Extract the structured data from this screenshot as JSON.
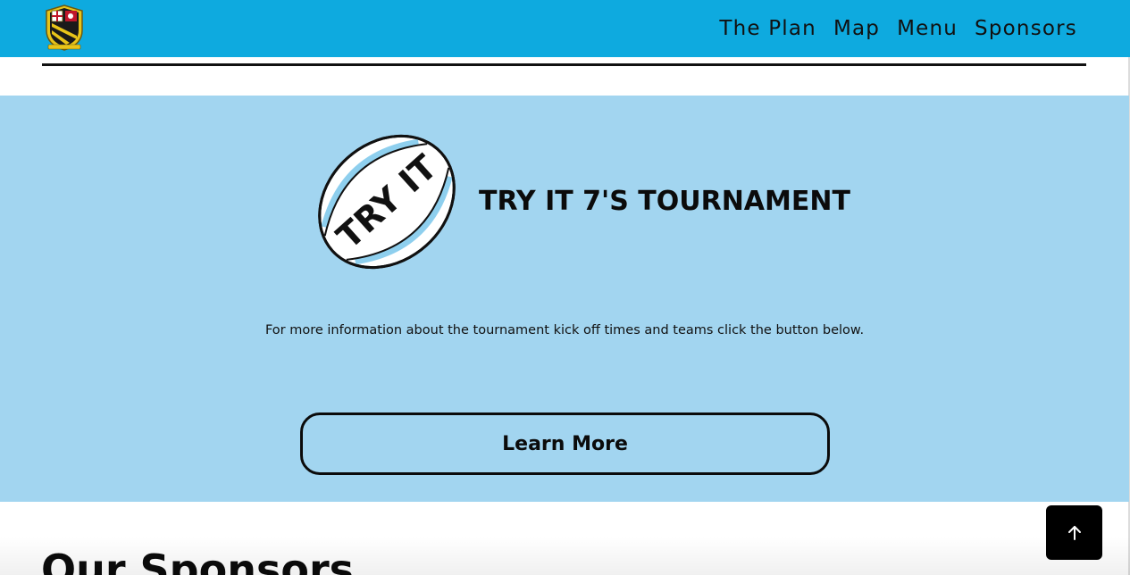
{
  "header": {
    "logo_alt": "club crest",
    "nav": {
      "plan": "The Plan",
      "map": "Map",
      "menu": "Menu",
      "sponsors": "Sponsors"
    }
  },
  "tournament": {
    "ball_text": "TRY IT",
    "title": "TRY IT 7'S TOURNAMENT",
    "info": "For more information about the tournament kick off times and teams click the button below.",
    "button_label": "Learn More"
  },
  "sponsors": {
    "heading": "Our Sponsors"
  },
  "back_to_top": {
    "icon": "arrow-up-icon"
  },
  "colors": {
    "header_bg": "#0eaadf",
    "section_bg": "#a2d5f0",
    "text": "#0b0b0b",
    "ball_stripe": "#8ecfee"
  }
}
